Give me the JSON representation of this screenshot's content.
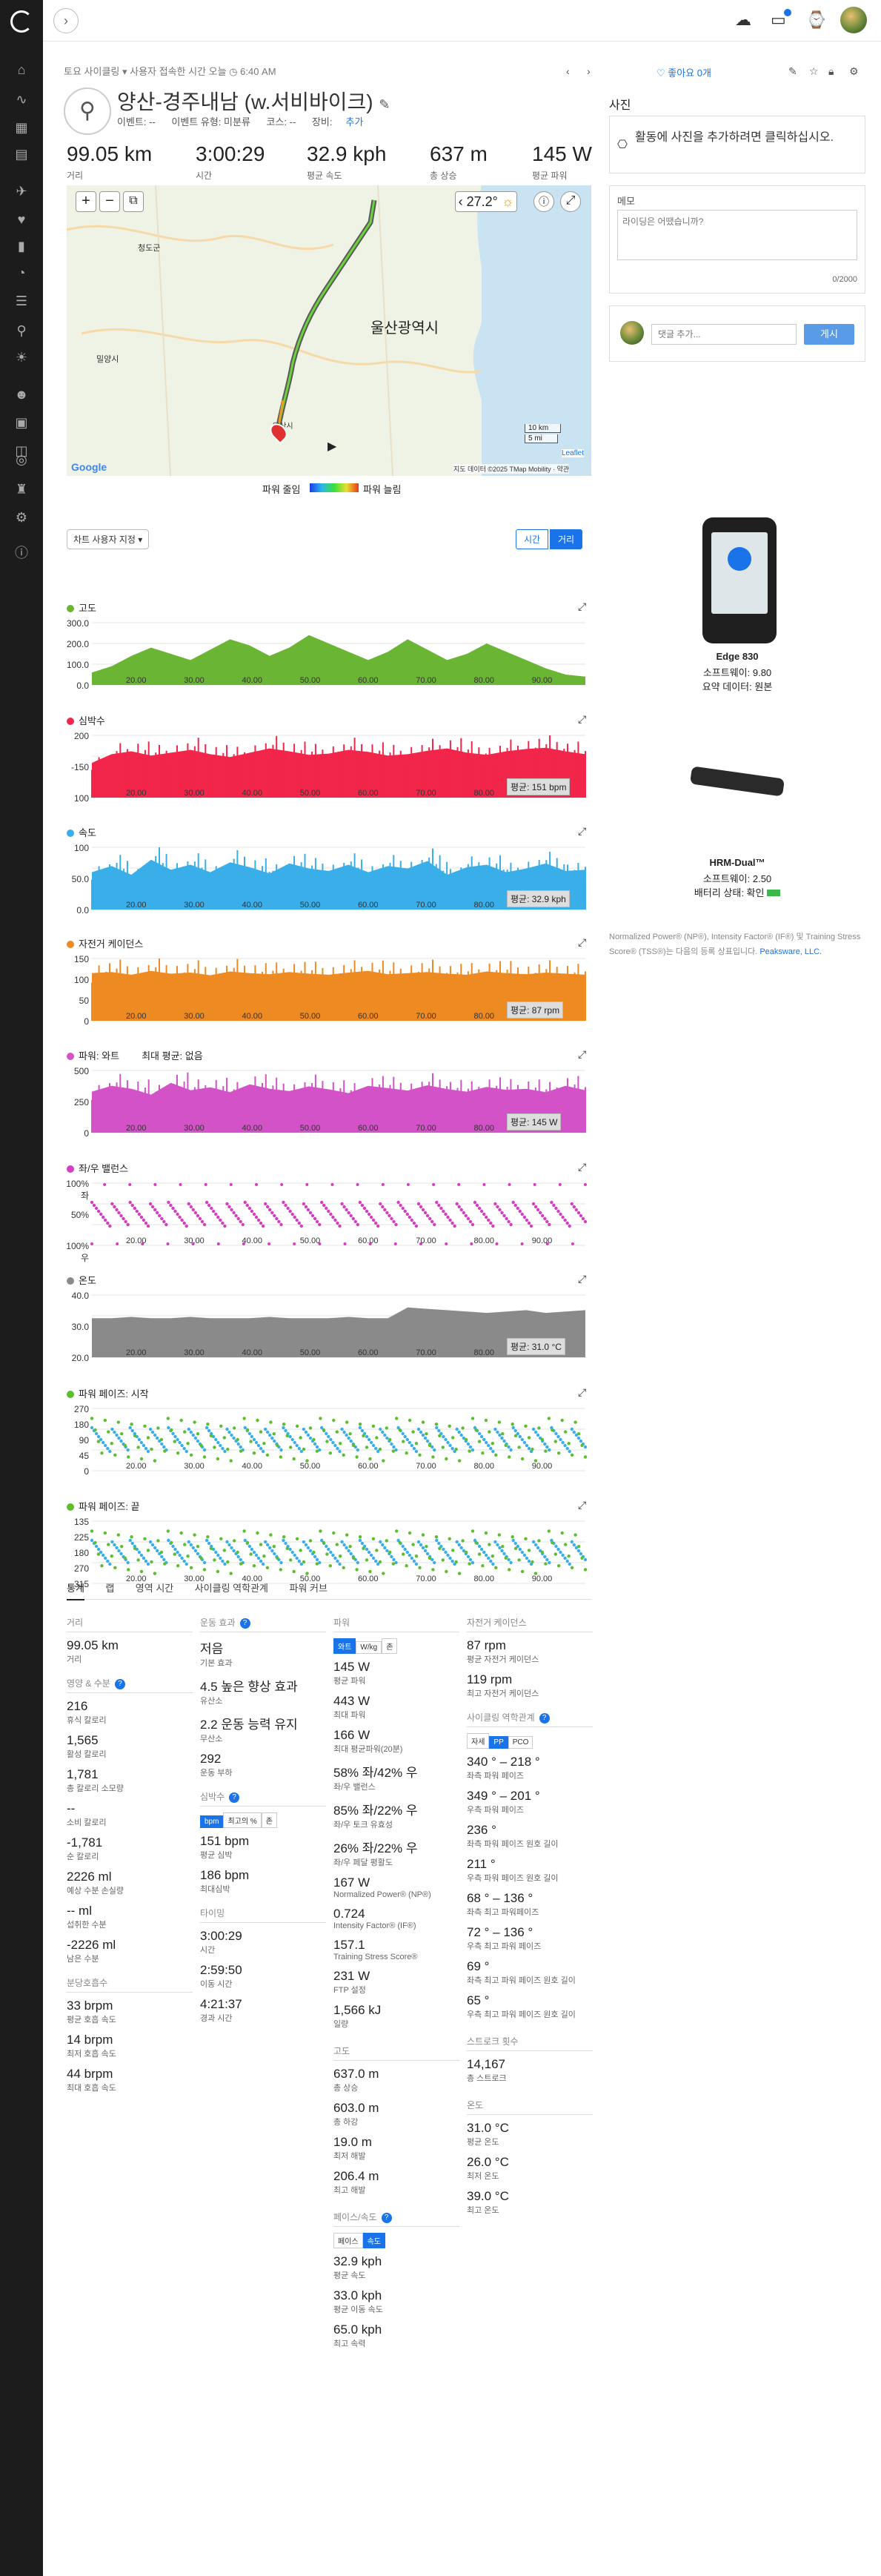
{
  "breadcrumb": {
    "prefix": "토요 사이클링",
    "middle": "사용자 접속한 시간 오늘",
    "time": "6:40 AM"
  },
  "activity": {
    "title": "양산-경주내남 (w.서비바이크)",
    "event": "이벤트: --",
    "event_type": "이벤트 유형: 미분류",
    "course": "코스: --",
    "gear": "장비:",
    "gear_add": "추가"
  },
  "like_label": "좋아요 0개",
  "summary": [
    {
      "value": "99.05 km",
      "label": "거리"
    },
    {
      "value": "3:00:29",
      "label": "시간"
    },
    {
      "value": "32.9 kph",
      "label": "평균 속도"
    },
    {
      "value": "637 m",
      "label": "총 상승"
    },
    {
      "value": "145 W",
      "label": "평균 파워"
    }
  ],
  "map": {
    "weather_temp": "27.2°",
    "city_label": "울산광역시",
    "town_labels": [
      "청도군",
      "밀양시",
      "양산시"
    ],
    "scale": [
      "10 km",
      "5 mi"
    ],
    "attribution": "지도 데이터 ©2025 TMap Mobility · 약관",
    "leaflet": "Leaflet",
    "google": "Google",
    "start_label": "양산시"
  },
  "power_legend": {
    "low": "파워 줄임",
    "high": "파워 늘림"
  },
  "chart_controls": {
    "custom": "차트 사용자 지정",
    "time": "시간",
    "distance": "거리"
  },
  "colors": {
    "accent": "#1a73e8",
    "elev": "#6ab634",
    "hr": "#f2254a",
    "speed": "#3aaee8",
    "cad": "#ee8a22",
    "power": "#d452c8",
    "balance": "#d43ec0",
    "temp": "#8a8a8a",
    "pp_green": "#5abf2a",
    "pp_blue": "#3aaee8"
  },
  "chart_data": [
    {
      "type": "area",
      "title": "고도",
      "ylabels": [
        "300.0",
        "200.0",
        "100.0",
        "0.0"
      ],
      "xticks": [
        "20.00",
        "30.00",
        "40.00",
        "50.00",
        "60.00",
        "70.00",
        "80.00",
        "90.00"
      ],
      "avg": "",
      "series": [
        {
          "values": [
            30,
            45,
            70,
            90,
            75,
            60,
            85,
            110,
            95,
            70,
            90,
            120,
            100,
            80,
            60,
            80,
            110,
            85,
            60,
            75,
            100,
            80,
            60,
            40,
            25,
            20
          ]
        }
      ]
    },
    {
      "type": "area",
      "title": "심박수",
      "ylabels": [
        "200",
        "-150",
        "100"
      ],
      "xticks": [
        "20.00",
        "30.00",
        "40.00",
        "50.00",
        "60.00",
        "70.00",
        "80.00",
        "90.00"
      ],
      "avg": "평균: 151 bpm",
      "series": [
        {
          "values": [
            120,
            150,
            160,
            145,
            155,
            165,
            150,
            140,
            155,
            170,
            160,
            148,
            152,
            165,
            158,
            145,
            150,
            162,
            170,
            155,
            148,
            160,
            168,
            172,
            160,
            150
          ]
        }
      ]
    },
    {
      "type": "area",
      "title": "속도",
      "ylabels": [
        "100",
        "50.0",
        "0.0"
      ],
      "xticks": [
        "20.00",
        "30.00",
        "40.00",
        "50.00",
        "60.00",
        "70.00",
        "80.00",
        "90.00"
      ],
      "avg": "평균: 32.9 kph",
      "series": [
        {
          "values": [
            30,
            35,
            28,
            40,
            32,
            36,
            30,
            38,
            34,
            29,
            37,
            33,
            31,
            36,
            30,
            35,
            33,
            39,
            28,
            34,
            36,
            30,
            33,
            37,
            31,
            32
          ]
        }
      ]
    },
    {
      "type": "area",
      "title": "자전거 케이던스",
      "ylabels": [
        "150",
        "100",
        "50",
        "0"
      ],
      "xticks": [
        "20.00",
        "30.00",
        "40.00",
        "50.00",
        "60.00",
        "70.00",
        "80.00",
        "90.00"
      ],
      "avg": "평균: 87 rpm",
      "series": [
        {
          "values": [
            88,
            90,
            85,
            92,
            87,
            89,
            84,
            91,
            88,
            86,
            90,
            87,
            85,
            89,
            92,
            86,
            88,
            90,
            87,
            85,
            91,
            88,
            86,
            89,
            87,
            85
          ]
        }
      ]
    },
    {
      "type": "area",
      "title": "파워: 와트",
      "ylabels": [
        "500",
        "250",
        "0"
      ],
      "xticks": [
        "20.00",
        "30.00",
        "40.00",
        "50.00",
        "60.00",
        "70.00",
        "80.00",
        "90.00"
      ],
      "avg": "평균: 145 W",
      "extra": "최대 평균: 없음",
      "series": [
        {
          "values": [
            140,
            160,
            150,
            130,
            170,
            145,
            155,
            138,
            165,
            150,
            142,
            158,
            148,
            135,
            160,
            152,
            144,
            162,
            149,
            140,
            156,
            146,
            150,
            138,
            160,
            145
          ]
        }
      ]
    },
    {
      "type": "scatter",
      "title": "좌/우 밸런스",
      "ylabels": [
        "100% 좌",
        "50%",
        "100% 우"
      ],
      "xticks": [
        "20.00",
        "30.00",
        "40.00",
        "50.00",
        "60.00",
        "70.00",
        "80.00",
        "90.00"
      ],
      "avg": ""
    },
    {
      "type": "area",
      "title": "온도",
      "ylabels": [
        "40.0",
        "30.0",
        "20.0"
      ],
      "xticks": [
        "20.00",
        "30.00",
        "40.00",
        "50.00",
        "60.00",
        "70.00",
        "80.00",
        "90.00"
      ],
      "avg": "평균: 31.0 °C",
      "series": [
        {
          "values": [
            29,
            29,
            30,
            29,
            29,
            30,
            29,
            29,
            29,
            30,
            29,
            29,
            29,
            30,
            29,
            29,
            37,
            36,
            35,
            34,
            33,
            34,
            35,
            33,
            34,
            35
          ]
        }
      ]
    },
    {
      "type": "scatter",
      "title": "파워 페이즈: 시작",
      "ylabels": [
        "270",
        "180",
        "90",
        "45",
        "0"
      ],
      "xticks": [
        "20.00",
        "30.00",
        "40.00",
        "50.00",
        "60.00",
        "70.00",
        "80.00",
        "90.00"
      ],
      "avg": ""
    },
    {
      "type": "scatter",
      "title": "파워 페이즈: 끝",
      "ylabels": [
        "135",
        "225",
        "180",
        "270",
        "315"
      ],
      "xticks": [
        "20.00",
        "30.00",
        "40.00",
        "50.00",
        "60.00",
        "70.00",
        "80.00",
        "90.00"
      ],
      "avg": ""
    }
  ],
  "stat_tabs": [
    "통계",
    "랩",
    "영역 시간",
    "사이클링 역학관계",
    "파워 커브"
  ],
  "col1": {
    "distance_head": "거리",
    "distance": "99.05 km",
    "distance_label": "거리",
    "nutrition_head": "영양 & 수분",
    "items": [
      {
        "v": "216",
        "l": "휴식 칼로리"
      },
      {
        "v": "1,565",
        "l": "활성 칼로리"
      },
      {
        "v": "1,781",
        "l": "총 칼로리 소모량"
      },
      {
        "v": "--",
        "l": "소비 칼로리"
      },
      {
        "v": "-1,781",
        "l": "순 칼로리"
      },
      {
        "v": "2226 ml",
        "l": "예상 수분 손실량"
      },
      {
        "v": "-- ml",
        "l": "섭취한 수분"
      },
      {
        "v": "-2226 ml",
        "l": "남은 수분"
      }
    ],
    "resp_head": "분당호흡수",
    "resp": [
      {
        "v": "33 brpm",
        "l": "평균 호흡 속도"
      },
      {
        "v": "14 brpm",
        "l": "최저 호흡 속도"
      },
      {
        "v": "44 brpm",
        "l": "최대 호흡 속도"
      }
    ]
  },
  "col2": {
    "effect_head": "운동 효과",
    "effect": [
      {
        "v": "저음",
        "l": "기본 효과"
      },
      {
        "v": "4.5 높은 향상 효과",
        "l": "유산소"
      },
      {
        "v": "2.2 운동 능력 유지",
        "l": "무산소"
      },
      {
        "v": "292",
        "l": "운동 부하"
      }
    ],
    "hr_head": "심박수",
    "hr_toggle": [
      "bpm",
      "최고의 %",
      "존"
    ],
    "hr": [
      {
        "v": "151 bpm",
        "l": "평균 심박"
      },
      {
        "v": "186 bpm",
        "l": "최대심박"
      }
    ],
    "timing_head": "타이밍",
    "timing": [
      {
        "v": "3:00:29",
        "l": "시간"
      },
      {
        "v": "2:59:50",
        "l": "이동 시간"
      },
      {
        "v": "4:21:37",
        "l": "경과 시간"
      }
    ]
  },
  "col3": {
    "power_head": "파워",
    "power_toggle": [
      "와트",
      "W/kg",
      "존"
    ],
    "power": [
      {
        "v": "145 W",
        "l": "평균 파워"
      },
      {
        "v": "443 W",
        "l": "최대 파워"
      },
      {
        "v": "166 W",
        "l": "최대 평균파워(20분)"
      },
      {
        "v": "58% 좌/42% 우",
        "l": "좌/우 밸런스"
      },
      {
        "v": "85% 좌/22% 우",
        "l": "좌/우 토크 유효성"
      },
      {
        "v": "26% 좌/22% 우",
        "l": "좌/우 페달 평활도"
      },
      {
        "v": "167 W",
        "l": "Normalized Power® (NP®)"
      },
      {
        "v": "0.724",
        "l": "Intensity Factor® (IF®)"
      },
      {
        "v": "157.1",
        "l": "Training Stress Score®"
      },
      {
        "v": "231 W",
        "l": "FTP 설정"
      },
      {
        "v": "1,566 kJ",
        "l": "일량"
      }
    ],
    "elev_head": "고도",
    "elev": [
      {
        "v": "637.0 m",
        "l": "총 상승"
      },
      {
        "v": "603.0 m",
        "l": "총 하강"
      },
      {
        "v": "19.0 m",
        "l": "최저 해발"
      },
      {
        "v": "206.4 m",
        "l": "최고 해발"
      }
    ],
    "pace_head": "페이스/속도",
    "pace_toggle": [
      "페이스",
      "속도"
    ],
    "pace": [
      {
        "v": "32.9 kph",
        "l": "평균 속도"
      },
      {
        "v": "33.0 kph",
        "l": "평균 이동 속도"
      },
      {
        "v": "65.0 kph",
        "l": "최고 속력"
      }
    ]
  },
  "col4": {
    "cad_head": "자전거 케이던스",
    "cad": [
      {
        "v": "87 rpm",
        "l": "평균 자전거 케이던스"
      },
      {
        "v": "119 rpm",
        "l": "최고 자전거 케이던스"
      }
    ],
    "dyn_head": "사이클링 역학관계",
    "dyn_toggle": [
      "자세",
      "PP",
      "PCO"
    ],
    "dyn": [
      {
        "v": "340 ° – 218 °",
        "l": "좌측 파워 페이즈"
      },
      {
        "v": "349 ° – 201 °",
        "l": "우측 파워 페이즈"
      },
      {
        "v": "236 °",
        "l": "좌측 파워 페이즈 원호 길이"
      },
      {
        "v": "211 °",
        "l": "우측 파워 페이즈 원호 길이"
      },
      {
        "v": "68 ° – 136 °",
        "l": "좌측 최고 파워페이즈"
      },
      {
        "v": "72 ° – 136 °",
        "l": "우측 최고 파워 페이즈"
      },
      {
        "v": "69 °",
        "l": "좌측 최고 파워 페이즈 원호 길이"
      },
      {
        "v": "65 °",
        "l": "우측 최고 파워 페이즈 원호 길이"
      }
    ],
    "stroke_head": "스트로크 횟수",
    "stroke": [
      {
        "v": "14,167",
        "l": "총 스트로크"
      }
    ],
    "temp_head": "온도",
    "temp": [
      {
        "v": "31.0 °C",
        "l": "평균 온도"
      },
      {
        "v": "26.0 °C",
        "l": "최저 온도"
      },
      {
        "v": "39.0 °C",
        "l": "최고 온도"
      }
    ]
  },
  "right": {
    "photos_title": "사진",
    "add_photo": "활동에 사진을 추가하려면 클릭하십시오.",
    "memo_title": "메모",
    "memo_placeholder": "라이딩은 어땠습니까?",
    "memo_count": "0/2000",
    "comment_placeholder": "댓글 추가...",
    "post": "게시",
    "device1": {
      "name": "Edge 830",
      "fw": "소프트웨이: 9.80",
      "data": "요약 데이터: 원본"
    },
    "device2": {
      "name": "HRM-Dual™",
      "fw": "소프트웨이: 2.50",
      "battery": "배터리 상태: 확인"
    },
    "note": "Normalized Power® (NP®), Intensity Factor® (IF®) 및 Training Stress Score® (TSS®)는 다음의 등록 상표입니다.",
    "note_link": "Peaksware, LLC."
  }
}
